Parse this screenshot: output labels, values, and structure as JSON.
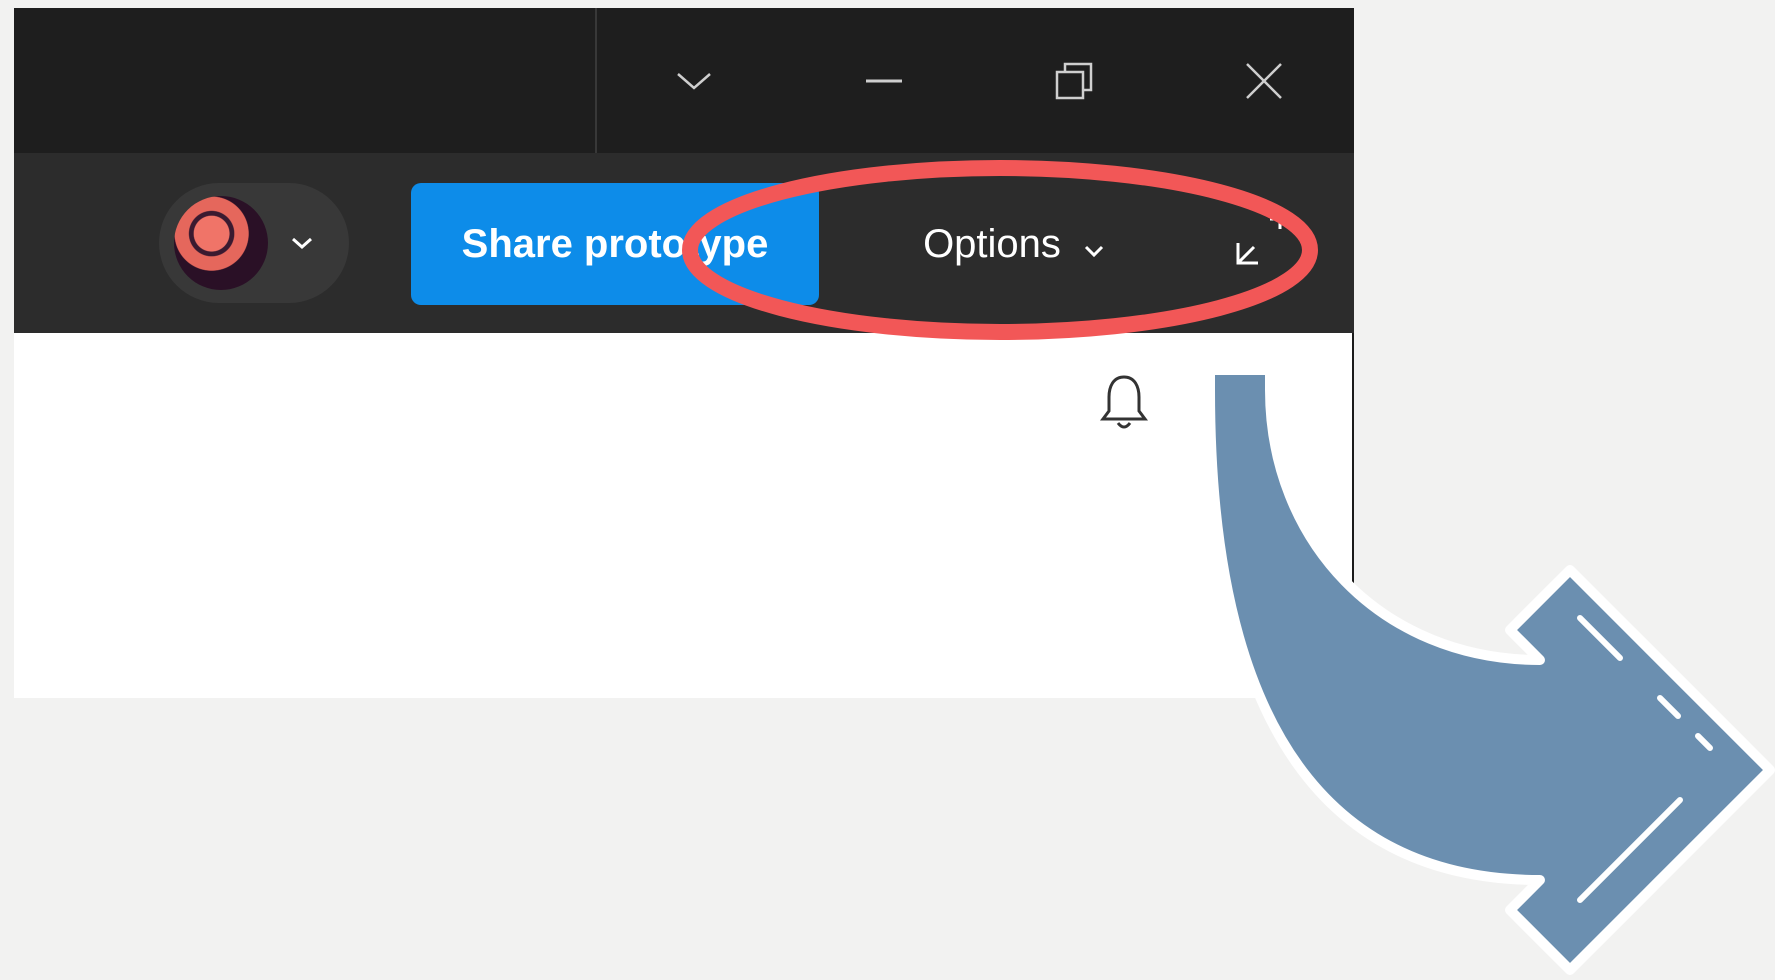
{
  "window_controls": {
    "dropdown_icon": "chevron-down-icon",
    "minimize_icon": "minimize-icon",
    "restore_icon": "restore-icon",
    "close_icon": "close-icon"
  },
  "toolbar": {
    "share_label": "Share prototype",
    "options_label": "Options",
    "accent_color": "#0d8ce9"
  },
  "annotation": {
    "highlight_color": "#f25757",
    "arrow_color": "#6b8fb0"
  }
}
